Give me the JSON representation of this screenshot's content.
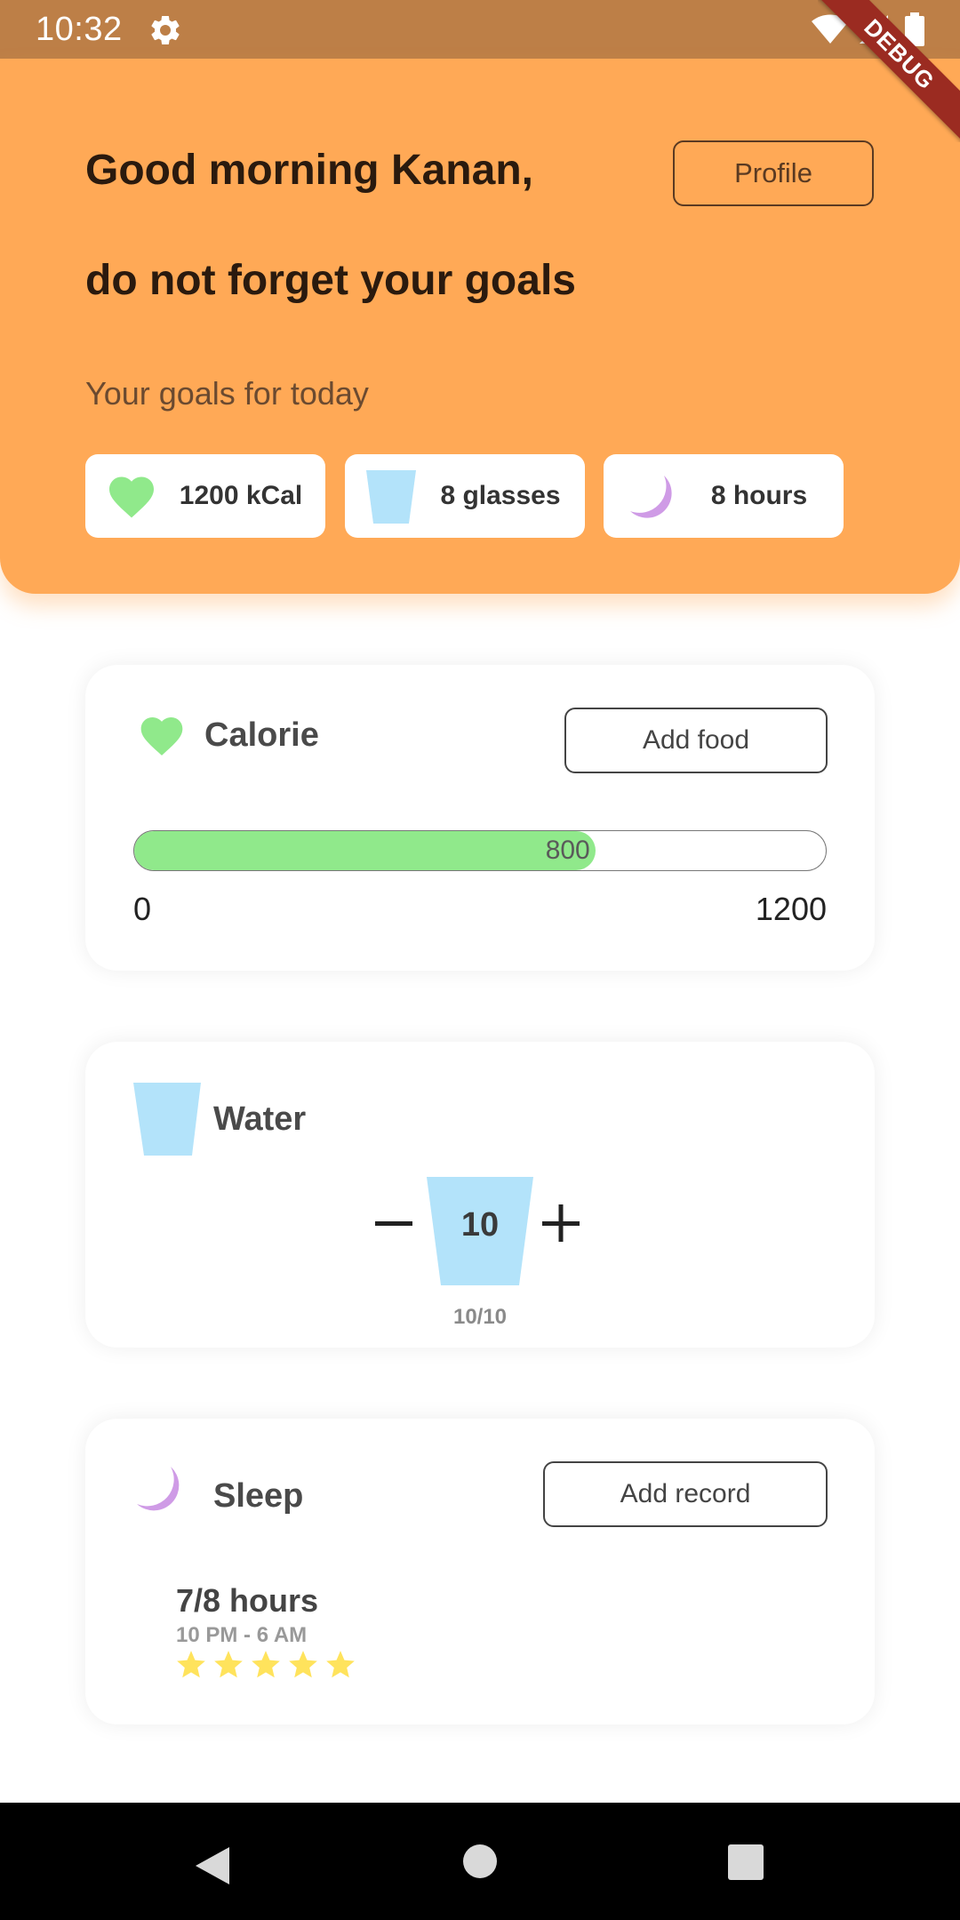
{
  "status_bar": {
    "time": "10:32",
    "icons": [
      "gear-icon",
      "wifi-icon",
      "signal-icon",
      "battery-icon"
    ]
  },
  "debug_banner": "DEBUG",
  "header": {
    "greeting_line1": "Good morning Kanan,",
    "greeting_line2": "do not forget your goals",
    "profile_button": "Profile",
    "goals_label": "Your goals for today",
    "goals": [
      {
        "icon": "heart-icon",
        "label": "1200 kCal"
      },
      {
        "icon": "glass-icon",
        "label": "8 glasses"
      },
      {
        "icon": "moon-icon",
        "label": "8 hours"
      }
    ]
  },
  "calorie_card": {
    "title": "Calorie",
    "add_button": "Add food",
    "current": "800",
    "min": "0",
    "max": "1200",
    "progress_fraction": 0.6667
  },
  "water_card": {
    "title": "Water",
    "count": "10",
    "progress_text": "10/10"
  },
  "sleep_card": {
    "title": "Sleep",
    "add_button": "Add record",
    "hours": "7/8 hours",
    "time_range": "10 PM - 6 AM",
    "rating": 5
  },
  "colors": {
    "status_bar": "#bd7f47",
    "header_bg": "#ffa956",
    "calorie_green": "#90e98b",
    "water_blue": "#b3e3fa",
    "moon_purple": "#cf9be6",
    "star_yellow": "#ffe35c"
  }
}
